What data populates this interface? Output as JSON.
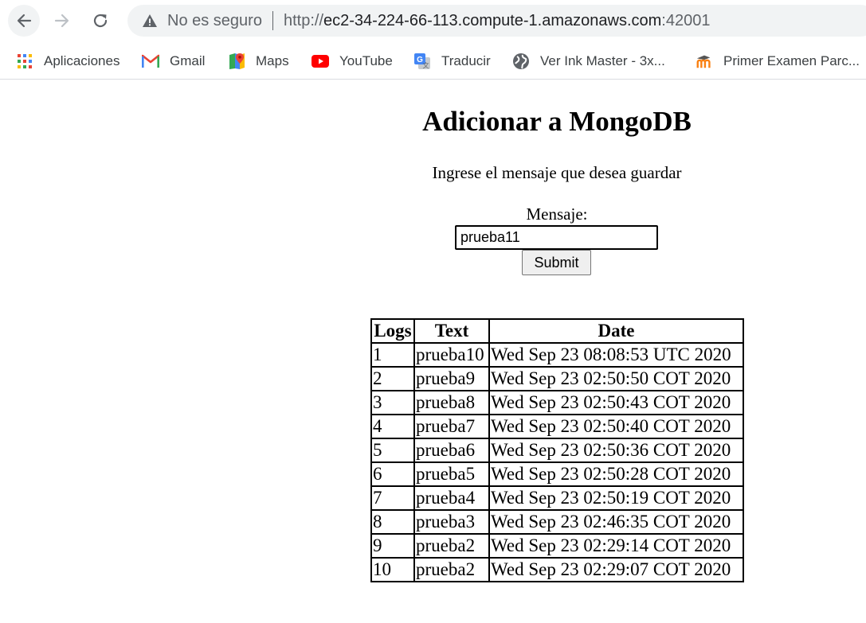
{
  "browser": {
    "security_label": "No es seguro",
    "url_scheme": "http://",
    "url_host": "ec2-34-224-66-113.compute-1.amazonaws.com",
    "url_port": ":42001",
    "icons": {
      "back": "back-arrow-icon",
      "forward": "forward-arrow-icon",
      "reload": "reload-icon",
      "warning": "warning-triangle-icon"
    }
  },
  "bookmarks": [
    {
      "label": "Aplicaciones",
      "icon": "apps-grid-icon"
    },
    {
      "label": "Gmail",
      "icon": "gmail-icon"
    },
    {
      "label": "Maps",
      "icon": "maps-icon"
    },
    {
      "label": "YouTube",
      "icon": "youtube-icon"
    },
    {
      "label": "Traducir",
      "icon": "translate-icon"
    },
    {
      "label": "Ver Ink Master - 3x...",
      "icon": "globe-icon"
    },
    {
      "label": "Primer Examen Parc...",
      "icon": "moodle-icon"
    }
  ],
  "page": {
    "title": "Adicionar a MongoDB",
    "subtitle": "Ingrese el mensaje que desea guardar",
    "field_label": "Mensaje:",
    "input_value": "prueba11",
    "submit_label": "Submit"
  },
  "table": {
    "headers": [
      "Logs",
      "Text",
      "Date"
    ],
    "rows": [
      [
        "1",
        "prueba10",
        "Wed Sep 23 08:08:53 UTC 2020"
      ],
      [
        "2",
        "prueba9",
        "Wed Sep 23 02:50:50 COT 2020"
      ],
      [
        "3",
        "prueba8",
        "Wed Sep 23 02:50:43 COT 2020"
      ],
      [
        "4",
        "prueba7",
        "Wed Sep 23 02:50:40 COT 2020"
      ],
      [
        "5",
        "prueba6",
        "Wed Sep 23 02:50:36 COT 2020"
      ],
      [
        "6",
        "prueba5",
        "Wed Sep 23 02:50:28 COT 2020"
      ],
      [
        "7",
        "prueba4",
        "Wed Sep 23 02:50:19 COT 2020"
      ],
      [
        "8",
        "prueba3",
        "Wed Sep 23 02:46:35 COT 2020"
      ],
      [
        "9",
        "prueba2",
        "Wed Sep 23 02:29:14 COT 2020"
      ],
      [
        "10",
        "prueba2",
        "Wed Sep 23 02:29:07 COT 2020"
      ]
    ]
  }
}
